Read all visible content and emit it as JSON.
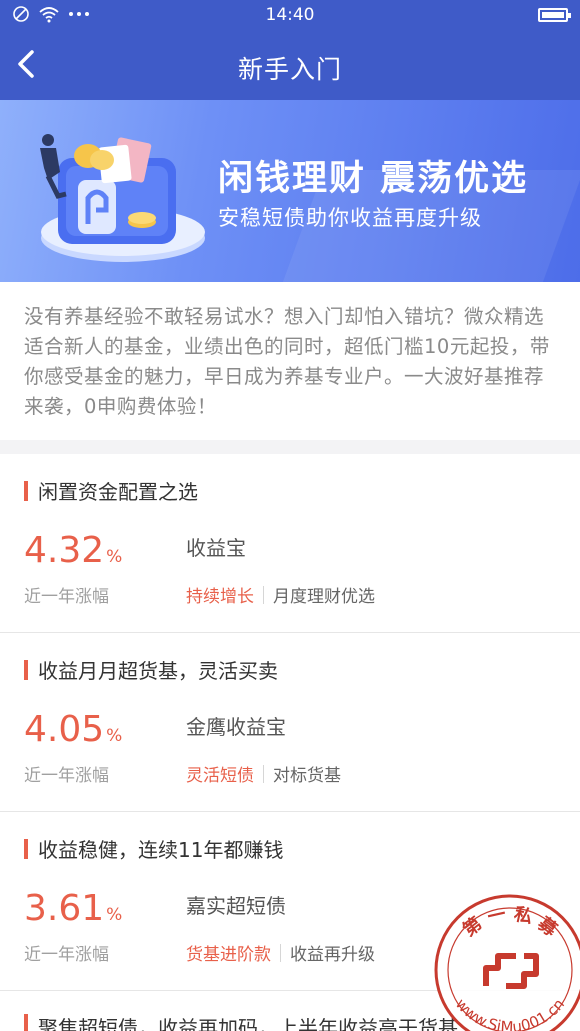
{
  "status_bar": {
    "time": "14:40"
  },
  "nav": {
    "title": "新手入门"
  },
  "banner": {
    "headline": "闲钱理财 震荡优选",
    "subtitle": "安稳短债助你收益再度升级"
  },
  "intro": "没有养基经验不敢轻易试水？想入门却怕入错坑？微众精选适合新人的基金，业绩出色的同时，超低门槛10元起投，带你感受基金的魅力，早日成为养基专业户。一大波好基推荐来袭，0申购费体验！",
  "sections": [
    {
      "heading": "闲置资金配置之选",
      "rate": "4.32",
      "unit": "%",
      "rate_label": "近一年涨幅",
      "fund_name": "收益宝",
      "tag_primary": "持续增长",
      "tag_secondary": "月度理财优选"
    },
    {
      "heading": "收益月月超货基，灵活买卖",
      "rate": "4.05",
      "unit": "%",
      "rate_label": "近一年涨幅",
      "fund_name": "金鹰收益宝",
      "tag_primary": "灵活短债",
      "tag_secondary": "对标货基"
    },
    {
      "heading": "收益稳健，连续11年都赚钱",
      "rate": "3.61",
      "unit": "%",
      "rate_label": "近一年涨幅",
      "fund_name": "嘉实超短债",
      "tag_primary": "货基进阶款",
      "tag_secondary": "收益再升级"
    }
  ],
  "partial_section": {
    "heading": "聚焦超短债，收益再加码，上半年收益高于货基"
  },
  "watermark": {
    "text_top": "第 一 私 募",
    "text_bottom": "www.SiMu001.cn"
  },
  "colors": {
    "nav_bg": "#3f5bc8",
    "accent": "#e8604a",
    "banner_start": "#8fb0fb",
    "banner_end": "#4d6de9"
  }
}
